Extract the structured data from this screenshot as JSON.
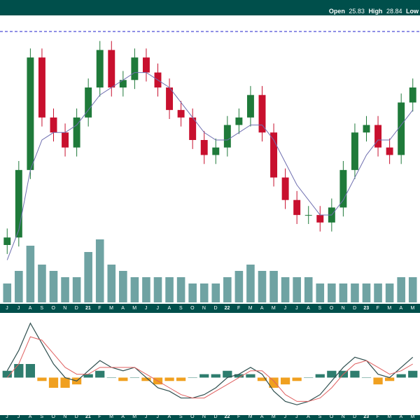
{
  "header": {
    "open_label": "Open",
    "open_value": "25.83",
    "high_label": "High",
    "high_value": "28.84",
    "low_label": "Low"
  },
  "colors": {
    "frame": "#004f4b",
    "up_candle": "#1f7a3a",
    "down_candle": "#c8102e",
    "moving_average": "#6f6fb0",
    "volume": "#6fa3a3",
    "macd_line": "#2f4f4f",
    "signal_line": "#e06060",
    "hist_positive": "#2e7d6e",
    "hist_negative": "#f0a020",
    "dashed_high": "#2222cc"
  },
  "x_axis": {
    "ticks": [
      "J",
      "J",
      "A",
      "S",
      "O",
      "N",
      "D",
      "21",
      "F",
      "M",
      "A",
      "M",
      "J",
      "J",
      "A",
      "S",
      "O",
      "N",
      "D",
      "22",
      "F",
      "M",
      "A",
      "M",
      "J",
      "J",
      "A",
      "S",
      "O",
      "N",
      "D",
      "23",
      "F",
      "M",
      "A",
      "M"
    ],
    "bold_ticks": [
      "21",
      "22",
      "23"
    ]
  },
  "chart_data": [
    {
      "type": "candlestick",
      "title": "",
      "description_series": [
        "price",
        "moving_average"
      ],
      "x": [
        "2020-06",
        "2020-07",
        "2020-08",
        "2020-09",
        "2020-10",
        "2020-11",
        "2020-12",
        "2021-01",
        "2021-02",
        "2021-03",
        "2021-04",
        "2021-05",
        "2021-06",
        "2021-07",
        "2021-08",
        "2021-09",
        "2021-10",
        "2021-11",
        "2021-12",
        "2022-01",
        "2022-02",
        "2022-03",
        "2022-04",
        "2022-05",
        "2022-06",
        "2022-07",
        "2022-08",
        "2022-09",
        "2022-10",
        "2022-11",
        "2022-12",
        "2023-01",
        "2023-02",
        "2023-03",
        "2023-04",
        "2023-05"
      ],
      "close_approx": [
        9,
        18,
        33,
        25,
        23,
        21,
        25,
        29,
        34,
        29,
        30,
        33,
        31,
        29,
        26,
        25,
        22,
        20,
        21,
        24,
        25,
        28,
        23,
        17,
        14,
        12,
        12,
        11,
        13,
        18,
        23,
        24,
        21,
        20,
        27,
        29
      ],
      "moving_average_approx": [
        6,
        10,
        18,
        22,
        23,
        23,
        24,
        26,
        28,
        29,
        30,
        31,
        31,
        30,
        29,
        27,
        25,
        23,
        22,
        22,
        23,
        24,
        24,
        22,
        19,
        16,
        14,
        12,
        12,
        14,
        17,
        20,
        22,
        22,
        24,
        26
      ],
      "y_range_note": "price axis not printed",
      "dashed_reference_high": 28.84
    },
    {
      "type": "bar",
      "series": [
        {
          "name": "",
          "values": [
            3,
            5,
            9,
            6,
            5,
            4,
            4,
            8,
            10,
            6,
            5,
            4,
            4,
            4,
            4,
            4,
            3,
            3,
            3,
            4,
            5,
            6,
            5,
            5,
            4,
            4,
            4,
            3,
            3,
            3,
            3,
            3,
            3,
            3,
            4,
            4
          ]
        }
      ]
    },
    {
      "type": "line",
      "series": [
        {
          "name": "",
          "values": [
            0.2,
            0.8,
            1.6,
            1.0,
            0.4,
            0.0,
            -0.1,
            0.2,
            0.5,
            0.3,
            0.2,
            0.3,
            0.0,
            -0.3,
            -0.4,
            -0.6,
            -0.6,
            -0.5,
            -0.3,
            0.0,
            0.1,
            0.3,
            0.1,
            -0.4,
            -0.7,
            -0.8,
            -0.7,
            -0.5,
            -0.1,
            0.3,
            0.6,
            0.5,
            0.1,
            0.0,
            0.3,
            0.6
          ]
        },
        {
          "name": "",
          "values": [
            0.0,
            0.4,
            1.2,
            1.1,
            0.7,
            0.3,
            0.1,
            0.1,
            0.3,
            0.3,
            0.3,
            0.3,
            0.1,
            -0.1,
            -0.3,
            -0.5,
            -0.6,
            -0.6,
            -0.4,
            -0.2,
            0.0,
            0.2,
            0.2,
            -0.1,
            -0.5,
            -0.7,
            -0.7,
            -0.6,
            -0.3,
            0.1,
            0.4,
            0.5,
            0.3,
            0.1,
            0.2,
            0.4
          ]
        }
      ],
      "histogram": [
        0.2,
        0.4,
        0.4,
        -0.1,
        -0.3,
        -0.3,
        -0.2,
        0.1,
        0.2,
        0.0,
        -0.1,
        0.0,
        -0.1,
        -0.2,
        -0.1,
        -0.1,
        0.0,
        0.1,
        0.1,
        0.2,
        0.1,
        0.1,
        -0.1,
        -0.3,
        -0.2,
        -0.1,
        0.0,
        0.1,
        0.2,
        0.2,
        0.2,
        0.0,
        -0.2,
        -0.1,
        0.1,
        0.2
      ]
    }
  ]
}
